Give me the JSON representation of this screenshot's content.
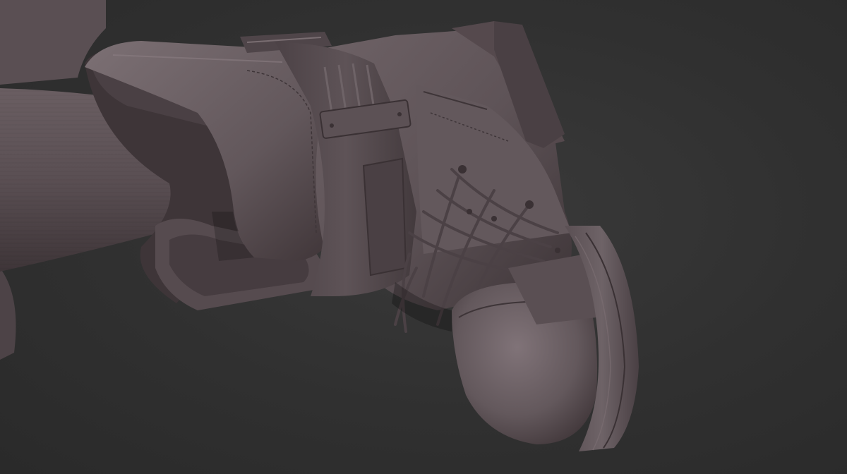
{
  "scene": {
    "subject": "sculpted-boot-render",
    "background_color": "#2f2f2f",
    "material_color": "#6b5f63",
    "material_shadow_color": "#3d3437",
    "material_highlight_color": "#8a7d82"
  }
}
